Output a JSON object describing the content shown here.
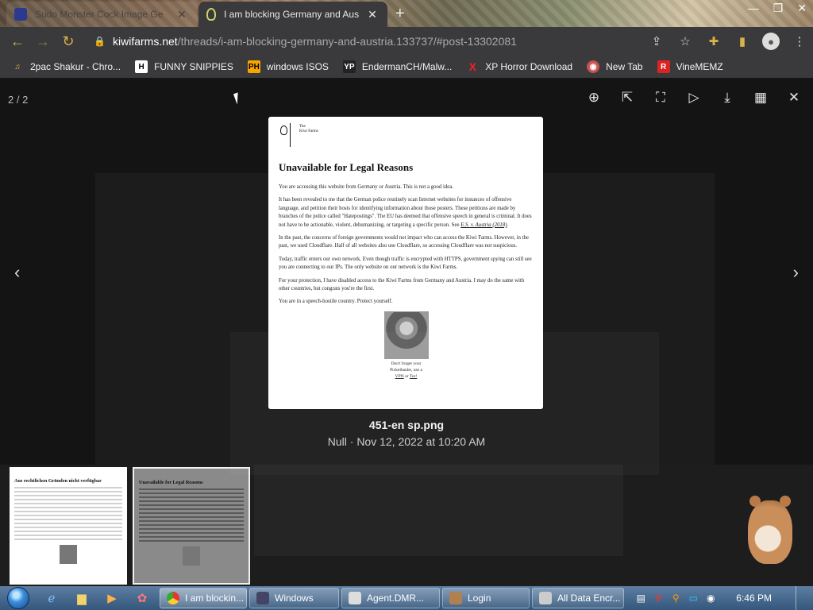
{
  "browser": {
    "tabs": [
      {
        "title": "Sudo Monster Cock Image Ge",
        "active": false
      },
      {
        "title": "I am blocking Germany and Aus",
        "active": true
      }
    ],
    "address": {
      "domain": "kiwifarms.net",
      "path": "/threads/i-am-blocking-germany-and-austria.133737/#post-13302081"
    },
    "bookmarks": [
      {
        "label": "2pac Shakur - Chro...",
        "icon": "music-icon"
      },
      {
        "label": "FUNNY SNIPPIES",
        "icon": "h-icon"
      },
      {
        "label": "windows ISOS",
        "icon": "ph-icon"
      },
      {
        "label": "EndermanCH/Malw...",
        "icon": "yp-icon"
      },
      {
        "label": "XP Horror Download",
        "icon": "x-icon"
      },
      {
        "label": "New Tab",
        "icon": "globe-icon"
      },
      {
        "label": "VineMEMZ",
        "icon": "r-icon"
      }
    ]
  },
  "viewer": {
    "counter": "2 / 2",
    "file_name": "451-en sp.png",
    "file_meta": "Null · Nov 12, 2022 at 10:20 AM"
  },
  "document": {
    "brand_line1": "The",
    "brand_line2": "Kiwi Farms",
    "title": "Unavailable for Legal Reasons",
    "p1": "You are accessing this website from Germany or Austria. This is not a good idea.",
    "p2": "It has been revealed to me that the German police routinely scan Internet websites for instances of offensive language, and petition their hosts for identifying information about those posters. These petitions are made by branches of the police called \"Hatepostings\". The EU has deemed that offensive speech in general is criminal. It does not have to be actionable, violent, dehumanizing, or targeting a specific person. See",
    "p2_link": "E.S. v. Austria (2018)",
    "p3": "In the past, the concerns of foreign governments would not impact who can access the Kiwi Farms. However, in the past, we used Cloudflare. Half of all websites also use Cloudflare, so accessing Cloudflare was not suspicious.",
    "p4": "Today, traffic enters our own network. Even though traffic is encrypted with HTTPS, government spying can still see you are connecting to our IPs. The only website on our network is the Kiwi Farms.",
    "p5": "For your protection, I have disabled access to the Kiwi Farms from Germany and Austria. I may do the same with other countries, but congrats you're the first.",
    "p6": "You are in a speech-hostile country. Protect yourself.",
    "caption_line1": "Don't forget your",
    "caption_line2": "Pickelhaube, use a",
    "caption_link1": "VPN",
    "caption_or": " or ",
    "caption_link2": "Tor!"
  },
  "thumbnails": [
    {
      "title": "Aus rechtlichen Gründen nicht verfügbar",
      "selected": false
    },
    {
      "title": "Unavailable for Legal Reasons",
      "selected": true
    }
  ],
  "taskbar": {
    "tasks": [
      {
        "label": "I am blockin...",
        "active": true
      },
      {
        "label": "Windows",
        "active": false
      },
      {
        "label": "Agent.DMR...",
        "active": false
      },
      {
        "label": "Login",
        "active": false
      },
      {
        "label": "All Data Encr...",
        "active": false
      }
    ],
    "clock": "6:46 PM"
  },
  "colors": {
    "accent": "#d8b24a",
    "chrome": "#3a3a3c",
    "viewer_bg": "#141414"
  }
}
